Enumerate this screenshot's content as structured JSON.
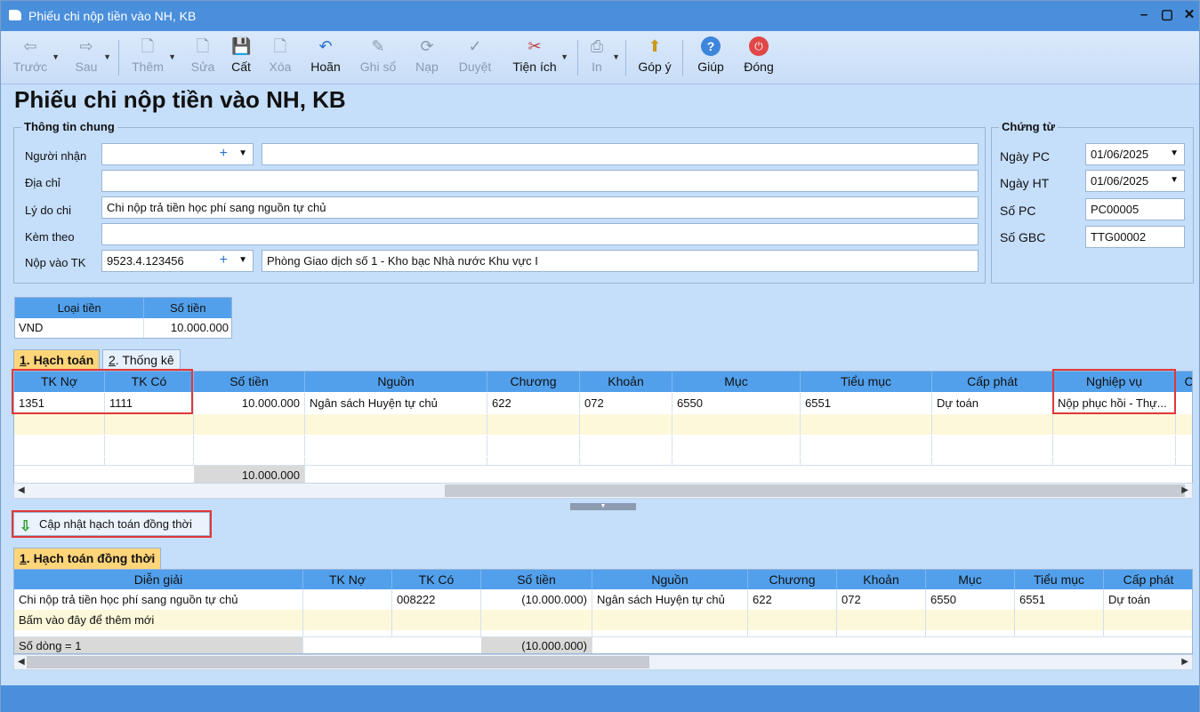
{
  "window": {
    "title": "Phiếu chi nộp tiền vào NH, KB"
  },
  "toolbar": {
    "prev": "Trước",
    "next": "Sau",
    "add": "Thêm",
    "edit": "Sửa",
    "save": "Cất",
    "delete": "Xóa",
    "undo": "Hoãn",
    "post": "Ghi sổ",
    "load": "Nạp",
    "approve": "Duyệt",
    "utilities": "Tiện ích",
    "print": "In",
    "feedback": "Góp ý",
    "help": "Giúp",
    "close": "Đóng"
  },
  "form": {
    "title": "Phiếu chi nộp tiền vào NH, KB",
    "general": {
      "legend": "Thông tin chung",
      "recipient_label": "Người nhận",
      "recipient_code": "",
      "recipient_name": "",
      "address_label": "Địa chỉ",
      "address": "",
      "reason_label": "Lý do chi",
      "reason": "Chi nộp trả tiền học phí sang nguồn tự chủ",
      "attach_label": "Kèm theo",
      "attach": "",
      "account_label": "Nộp vào TK",
      "account": "9523.4.123456",
      "account_name": "Phòng Giao dịch số 1 - Kho bạc Nhà nước Khu vực I"
    },
    "voucher": {
      "legend": "Chứng từ",
      "date_pc_label": "Ngày PC",
      "date_pc": "01/06/2025",
      "date_ht_label": "Ngày HT",
      "date_ht": "01/06/2025",
      "no_pc_label": "Số PC",
      "no_pc": "PC00005",
      "no_gbc_label": "Số GBC",
      "no_gbc": "TTG00002"
    }
  },
  "currency": {
    "headers": [
      "Loại tiền",
      "Số tiền"
    ],
    "row": [
      "VND",
      "10.000.000"
    ]
  },
  "tabs": {
    "tab1_num": "1",
    "tab1": ". Hạch toán",
    "tab2_num": "2",
    "tab2": ". Thống kê"
  },
  "posting": {
    "headers": [
      "TK Nợ",
      "TK Có",
      "Số tiền",
      "Nguồn",
      "Chương",
      "Khoản",
      "Mục",
      "Tiểu mục",
      "Cấp phát",
      "Nghiệp vụ",
      "C"
    ],
    "row": [
      "1351",
      "1111",
      "10.000.000",
      "Ngân sách Huyện tự chủ",
      "622",
      "072",
      "6550",
      "6551",
      "Dự toán",
      "Nộp phục hồi - Thự..."
    ],
    "total": "10.000.000"
  },
  "update_button": "Cập nhật hạch toán đồng thời",
  "tab3": {
    "num": "1",
    "label": ". Hạch toán đồng thời"
  },
  "simultaneous": {
    "headers": [
      "Diễn giải",
      "TK Nợ",
      "TK Có",
      "Số tiền",
      "Nguồn",
      "Chương",
      "Khoản",
      "Mục",
      "Tiểu mục",
      "Cấp phát"
    ],
    "row": [
      "Chi nộp trả tiền học phí sang nguồn tự chủ",
      "",
      "008222",
      "(10.000.000)",
      "Ngân sách Huyện tự chủ",
      "622",
      "072",
      "6550",
      "6551",
      "Dự toán"
    ],
    "new_row": "Bấm vào đây để thêm mới",
    "count": "Số dòng = 1",
    "total": "(10.000.000)"
  }
}
